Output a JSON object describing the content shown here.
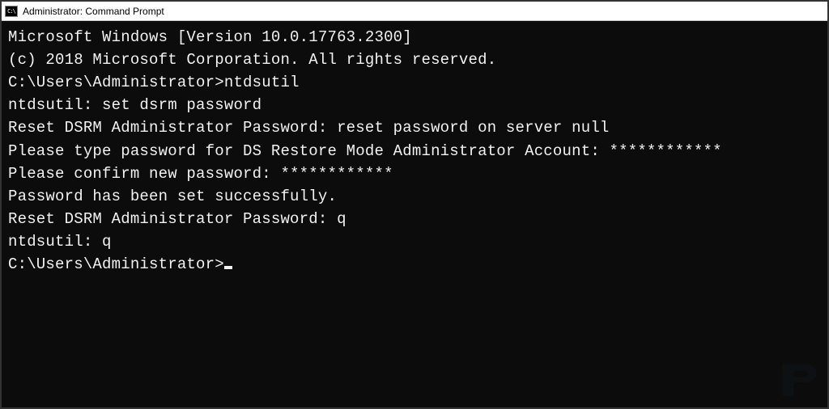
{
  "window": {
    "title": "Administrator: Command Prompt",
    "icon_label": "CMD"
  },
  "terminal": {
    "lines": [
      "Microsoft Windows [Version 10.0.17763.2300]",
      "(c) 2018 Microsoft Corporation. All rights reserved.",
      "",
      "C:\\Users\\Administrator>ntdsutil",
      "ntdsutil: set dsrm password",
      "Reset DSRM Administrator Password: reset password on server null",
      "Please type password for DS Restore Mode Administrator Account: ************",
      "Please confirm new password: ************",
      "Password has been set successfully.",
      "",
      "Reset DSRM Administrator Password: q",
      "ntdsutil: q",
      "",
      "C:\\Users\\Administrator>"
    ]
  }
}
